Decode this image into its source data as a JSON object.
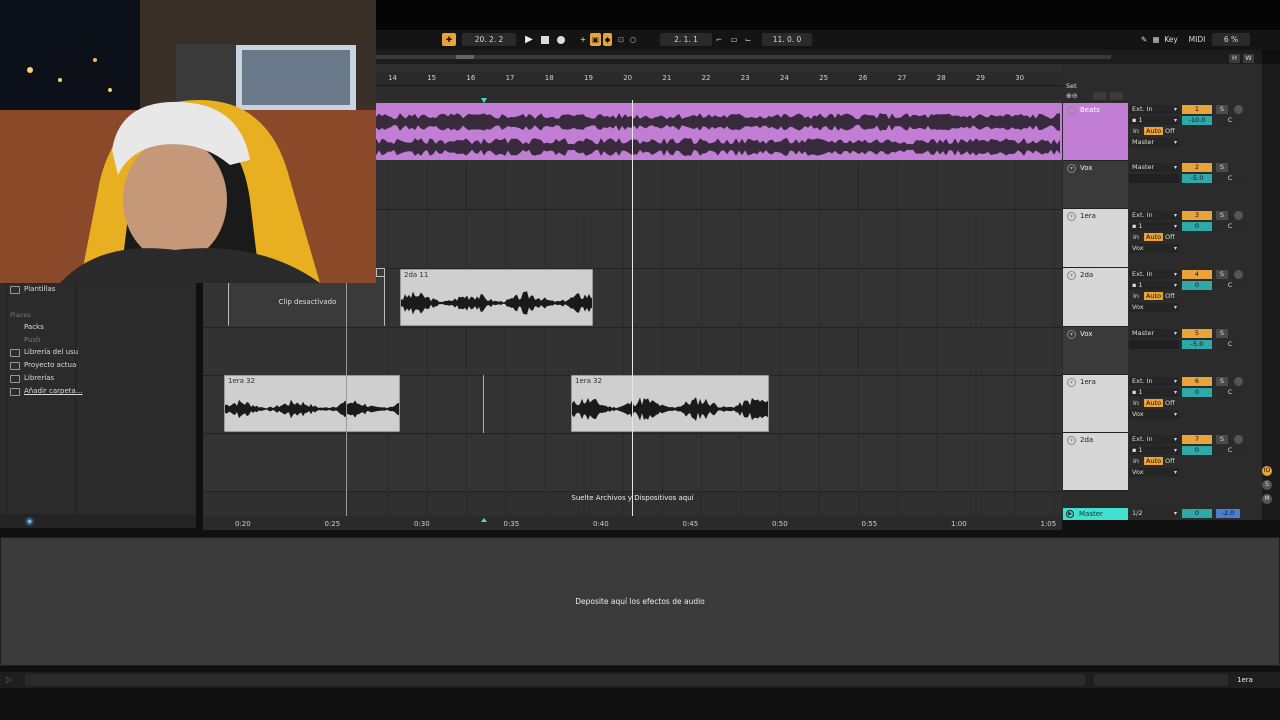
{
  "transport": {
    "tempo_bars": "20.  2.  2",
    "position": "2.  1.  1",
    "loop_length": "11.  0.  0",
    "key_label": "Key",
    "midi_label": "MIDI",
    "cpu": "6 %",
    "h_label": "H",
    "w_label": "W"
  },
  "ruler": {
    "bars": [
      "14",
      "15",
      "16",
      "17",
      "18",
      "19",
      "20",
      "21",
      "22",
      "23",
      "24",
      "25",
      "26",
      "27",
      "28",
      "29",
      "30"
    ]
  },
  "time_ruler": {
    "times": [
      "0:20",
      "0:25",
      "0:30",
      "0:35",
      "0:40",
      "0:45",
      "0:50",
      "0:55",
      "1:00",
      "1:05"
    ]
  },
  "browser": {
    "templates_label": "Plantillas",
    "places_header": "Places",
    "items": [
      "Packs",
      "Push",
      "Librería del usu",
      "Proyecto actua",
      "Librerías",
      "Añadir carpeta..."
    ]
  },
  "tracks": [
    {
      "name": "Beats",
      "input": "Ext. In",
      "channel": "1",
      "output": "Master",
      "number": "1",
      "volume": "-10.0",
      "pan": "C",
      "monitor": [
        "In",
        "Auto",
        "Off"
      ]
    },
    {
      "name": "Vox",
      "input": "Master",
      "number": "2",
      "volume": "-5.0",
      "pan": "C"
    },
    {
      "name": "1era",
      "input": "Ext. In",
      "channel": "1",
      "output": "Vox",
      "number": "3",
      "volume": "0",
      "pan": "C",
      "monitor": [
        "In",
        "Auto",
        "Off"
      ]
    },
    {
      "name": "2da",
      "input": "Ext. In",
      "channel": "1",
      "output": "Vox",
      "number": "4",
      "volume": "0",
      "pan": "C",
      "monitor": [
        "In",
        "Auto",
        "Off"
      ]
    },
    {
      "name": "Vox",
      "input": "Master",
      "number": "5",
      "volume": "-5.0",
      "pan": "C"
    },
    {
      "name": "1era",
      "input": "Ext. In",
      "channel": "1",
      "output": "Vox",
      "number": "6",
      "volume": "0",
      "pan": "C",
      "monitor": [
        "In",
        "Auto",
        "Off"
      ]
    },
    {
      "name": "2da",
      "input": "Ext. In",
      "channel": "1",
      "output": "Vox",
      "number": "7",
      "volume": "0",
      "pan": "C",
      "monitor": [
        "In",
        "Auto",
        "Off"
      ]
    }
  ],
  "master": {
    "name": "Master",
    "routing": "1/2",
    "volume": "0",
    "pan": "-2.0"
  },
  "clips": {
    "deactivated": "Clip desactivado",
    "clip_2da": "2da 11",
    "clip_1era_a": "1era 32",
    "clip_1era_b": "1era 32"
  },
  "drop_hint": "Suelte Archivos y Dispositivos aquí",
  "devices_hint": "Deposite aquí los efectos de audio",
  "status": {
    "selected_track": "1era"
  },
  "labels": {
    "set": "Set",
    "s": "S"
  },
  "colors": {
    "accent": "#e8a43a",
    "beats": "#c27ed4",
    "volume": "#2ea8a8",
    "master": "#3fe0d0"
  }
}
